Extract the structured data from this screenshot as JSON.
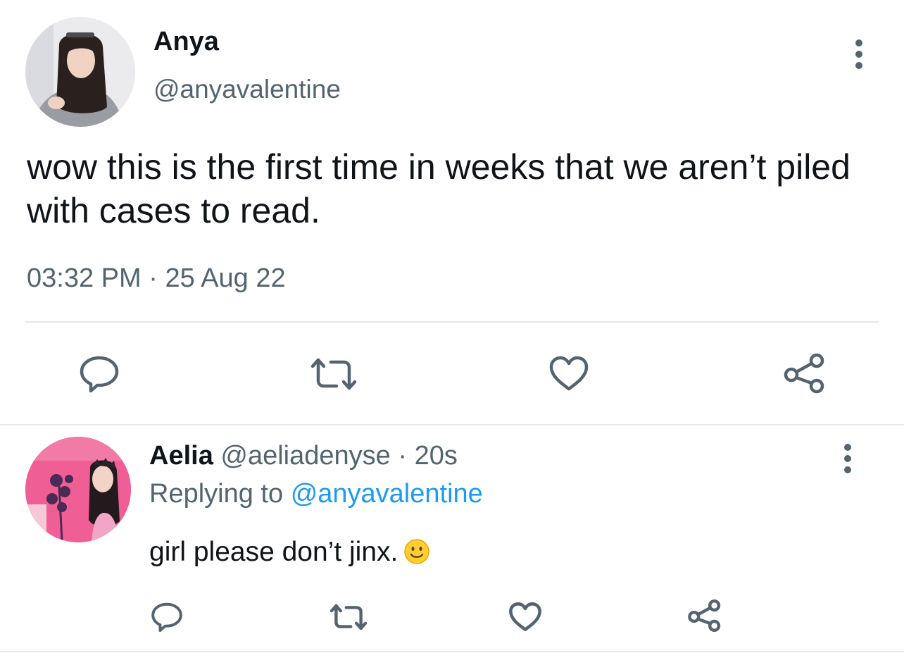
{
  "tweet": {
    "author_name": "Anya",
    "author_handle": "@anyavalentine",
    "text": "wow this is the first time in weeks that we aren’t piled with cases to read.",
    "time": "03:32 PM",
    "separator": "·",
    "date": "25 Aug 22",
    "actions": [
      {
        "icon": "reply-icon"
      },
      {
        "icon": "retweet-icon"
      },
      {
        "icon": "like-icon"
      },
      {
        "icon": "share-icon"
      }
    ]
  },
  "reply": {
    "author_name": "Aelia",
    "author_handle": "@aeliadenyse",
    "separator": "·",
    "age": "20s",
    "replying_to_prefix": "Replying to",
    "replying_to_handle": "@anyavalentine",
    "text": "girl please don’t jinx.",
    "emoji": "slightly-smiling-face",
    "actions": [
      {
        "icon": "reply-icon"
      },
      {
        "icon": "retweet-icon"
      },
      {
        "icon": "like-icon"
      },
      {
        "icon": "share-icon"
      }
    ]
  },
  "colors": {
    "primary_text": "#0f1419",
    "secondary_text": "#536471",
    "link": "#1d9bf0",
    "divider": "#e6e9ec"
  }
}
